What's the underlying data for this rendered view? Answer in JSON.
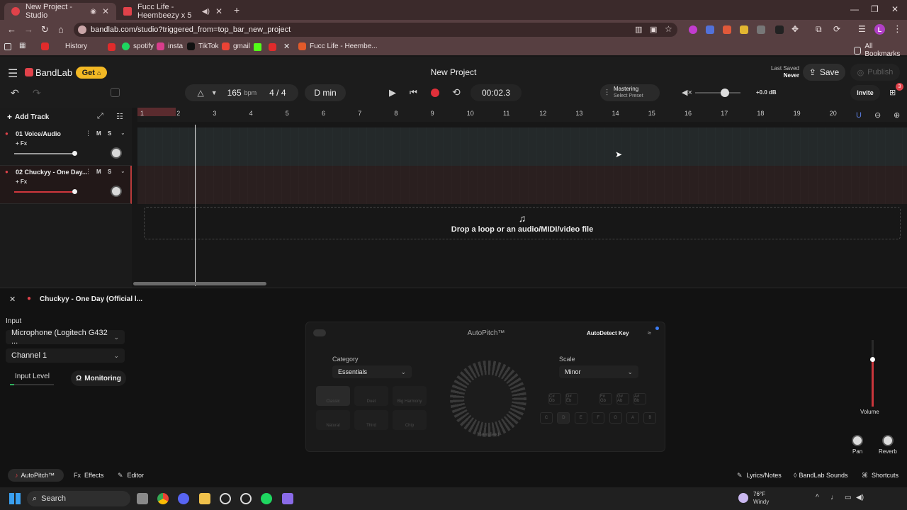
{
  "browser": {
    "tabs": [
      {
        "title": "New Project - Studio",
        "active": true
      },
      {
        "title": "Fucc Life - Heembeezy x 5",
        "active": false
      }
    ],
    "new_tab": "+",
    "url": "bandlab.com/studio?triggered_from=top_bar_new_project",
    "bookmarks": [
      "History",
      "spotify",
      "insta",
      "TikTok",
      "gmail",
      "Fucc Life - Heembe..."
    ],
    "all_bookmarks": "All Bookmarks"
  },
  "app": {
    "brand": "BandLab",
    "get_label": "Get",
    "project_title": "New Project",
    "last_saved_label": "Last Saved",
    "last_saved_value": "Never",
    "save_label": "Save",
    "publish_label": "Publish",
    "invite_label": "Invite",
    "notif_count": "3",
    "accent": "#e0424a"
  },
  "transport": {
    "bpm_value": "165",
    "bpm_unit": "bpm",
    "time_signature": "4 / 4",
    "key": "D min",
    "time": "00:02.3",
    "mastering_title": "Mastering",
    "mastering_sub": "Select Preset",
    "volume_db": "+0.0 dB"
  },
  "timeline": {
    "add_track": "Add Track",
    "bars": [
      "1",
      "2",
      "3",
      "4",
      "5",
      "6",
      "7",
      "8",
      "9",
      "10",
      "11",
      "12",
      "13",
      "14",
      "15",
      "16",
      "17",
      "18",
      "19",
      "20"
    ],
    "drop_text": "Drop a loop or an audio/MIDI/video file"
  },
  "tracks": [
    {
      "name": "01  Voice/Audio",
      "fx": "+ Fx",
      "mute": "M",
      "solo": "S"
    },
    {
      "name": "02  Chuckyy - One Day...",
      "fx": "+ Fx",
      "mute": "M",
      "solo": "S"
    }
  ],
  "editor": {
    "track_title": "Chuckyy - One Day (Official l...",
    "input_label": "Input",
    "microphone": "Microphone (Logitech G432 ...",
    "channel": "Channel 1",
    "input_level": "Input Level",
    "monitoring": "Monitoring",
    "autopitch_title": "AutoPitch™",
    "autodetect": "AutoDetect Key",
    "category_label": "Category",
    "category_value": "Essentials",
    "presets": [
      "Classic",
      "Duet",
      "Big Harmony",
      "Natural",
      "Third",
      "Chip"
    ],
    "knob_label": "Heaviest",
    "scale_label": "Scale",
    "scale_value": "Minor",
    "sharps": [
      "C#\nDb",
      "D#\nEb",
      "F#\nGb",
      "G#\nAb",
      "A#\nBb"
    ],
    "keys": [
      "C",
      "D",
      "E",
      "F",
      "G",
      "A",
      "B"
    ],
    "volume": "Volume",
    "pan": "Pan",
    "reverb": "Reverb"
  },
  "bottom_bar": {
    "autopitch": "AutoPitch™",
    "effects": "Effects",
    "editor": "Editor",
    "lyrics": "Lyrics/Notes",
    "sounds": "BandLab Sounds",
    "shortcuts": "Shortcuts"
  },
  "taskbar": {
    "search": "Search",
    "weather_temp": "76°F",
    "weather_desc": "Windy"
  }
}
